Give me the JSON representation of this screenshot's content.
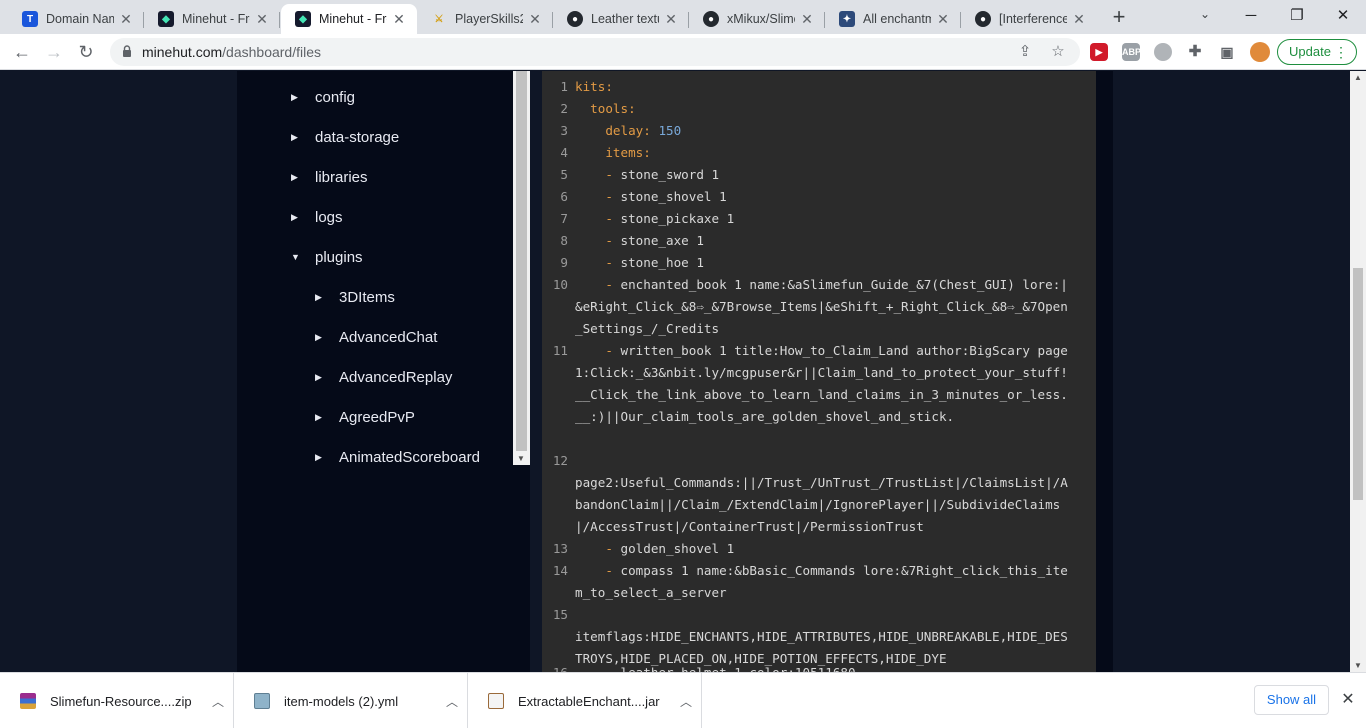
{
  "tabs": [
    {
      "title": "Domain Nam",
      "icon": "tab-favicon-t",
      "active": false
    },
    {
      "title": "Minehut - Fre",
      "icon": "minehut-icon",
      "active": false
    },
    {
      "title": "Minehut - Fre",
      "icon": "minehut-icon",
      "active": true
    },
    {
      "title": "PlayerSkills2 |",
      "icon": "playerskills-icon",
      "active": false
    },
    {
      "title": "Leather textu",
      "icon": "github-icon",
      "active": false
    },
    {
      "title": "xMikux/Slime",
      "icon": "github-icon",
      "active": false
    },
    {
      "title": "All enchantm",
      "icon": "enchantment-icon",
      "active": false
    },
    {
      "title": "[Interference",
      "icon": "github-icon",
      "active": false
    }
  ],
  "toolbar": {
    "url_host": "minehut.com",
    "url_path": "/dashboard/files",
    "update_label": "Update"
  },
  "file_tree": {
    "items": [
      {
        "label": "config",
        "expanded": false,
        "depth": 0
      },
      {
        "label": "data-storage",
        "expanded": false,
        "depth": 0
      },
      {
        "label": "libraries",
        "expanded": false,
        "depth": 0
      },
      {
        "label": "logs",
        "expanded": false,
        "depth": 0
      },
      {
        "label": "plugins",
        "expanded": true,
        "depth": 0
      },
      {
        "label": "3DItems",
        "expanded": false,
        "depth": 1
      },
      {
        "label": "AdvancedChat",
        "expanded": false,
        "depth": 1
      },
      {
        "label": "AdvancedReplay",
        "expanded": false,
        "depth": 1
      },
      {
        "label": "AgreedPvP",
        "expanded": false,
        "depth": 1
      },
      {
        "label": "AnimatedScoreboard",
        "expanded": false,
        "depth": 1
      }
    ]
  },
  "editor": {
    "lines": [
      {
        "n": "1",
        "segs": [
          {
            "t": "kits:",
            "c": "k"
          }
        ]
      },
      {
        "n": "2",
        "segs": [
          {
            "t": "  ",
            "c": ""
          },
          {
            "t": "tools:",
            "c": "k"
          }
        ]
      },
      {
        "n": "3",
        "segs": [
          {
            "t": "    ",
            "c": ""
          },
          {
            "t": "delay:",
            "c": "k"
          },
          {
            "t": " ",
            "c": ""
          },
          {
            "t": "150",
            "c": "n"
          }
        ]
      },
      {
        "n": "4",
        "segs": [
          {
            "t": "    ",
            "c": ""
          },
          {
            "t": "items:",
            "c": "k"
          }
        ]
      },
      {
        "n": "5",
        "segs": [
          {
            "t": "    ",
            "c": ""
          },
          {
            "t": "-",
            "c": "d"
          },
          {
            "t": " stone_sword 1",
            "c": ""
          }
        ]
      },
      {
        "n": "6",
        "segs": [
          {
            "t": "    ",
            "c": ""
          },
          {
            "t": "-",
            "c": "d"
          },
          {
            "t": " stone_shovel 1",
            "c": ""
          }
        ]
      },
      {
        "n": "7",
        "segs": [
          {
            "t": "    ",
            "c": ""
          },
          {
            "t": "-",
            "c": "d"
          },
          {
            "t": " stone_pickaxe 1",
            "c": ""
          }
        ]
      },
      {
        "n": "8",
        "segs": [
          {
            "t": "    ",
            "c": ""
          },
          {
            "t": "-",
            "c": "d"
          },
          {
            "t": " stone_axe 1",
            "c": ""
          }
        ]
      },
      {
        "n": "9",
        "segs": [
          {
            "t": "    ",
            "c": ""
          },
          {
            "t": "-",
            "c": "d"
          },
          {
            "t": " stone_hoe 1",
            "c": ""
          }
        ]
      },
      {
        "n": "10",
        "segs": [
          {
            "t": "    ",
            "c": ""
          },
          {
            "t": "-",
            "c": "d"
          },
          {
            "t": " enchanted_book 1 name:&aSlimefun_Guide_&7(Chest_GUI) lore:|&eRight_Click_&8⇨_&7Browse_Items|&eShift_+_Right_Click_&8⇨_&7Open_Settings_/_Credits",
            "c": ""
          }
        ]
      },
      {
        "n": "11",
        "segs": [
          {
            "t": "    ",
            "c": ""
          },
          {
            "t": "-",
            "c": "d"
          },
          {
            "t": " written_book 1 title:How_to_Claim_Land author:BigScary page1:Click:_&3&nbit.ly/mcgpuser&r||Claim_land_to_protect_your_stuff!__Click_the_link_above_to_learn_land_claims_in_3_minutes_or_less.__:)||Our_claim_tools_are_golden_shovel_and_stick.",
            "c": ""
          }
        ]
      },
      {
        "n": "12",
        "segs": [
          {
            "t": "page2:Useful_Commands:||/Trust_/UnTrust_/TrustList|/ClaimsList|/AbandonClaim||/Claim_/ExtendClaim|/IgnorePlayer||/SubdivideClaims|/AccessTrust|/ContainerTrust|/PermissionTrust",
            "c": ""
          }
        ]
      },
      {
        "n": "13",
        "segs": [
          {
            "t": "    ",
            "c": ""
          },
          {
            "t": "-",
            "c": "d"
          },
          {
            "t": " golden_shovel 1",
            "c": ""
          }
        ]
      },
      {
        "n": "14",
        "segs": [
          {
            "t": "    ",
            "c": ""
          },
          {
            "t": "-",
            "c": "d"
          },
          {
            "t": " compass 1 name:&bBasic_Commands lore:&7Right_click_this_item_to_select_a_server",
            "c": ""
          }
        ]
      },
      {
        "n": "15",
        "segs": [
          {
            "t": "itemflags:HIDE_ENCHANTS,HIDE_ATTRIBUTES,HIDE_UNBREAKABLE,HIDE_DESTROYS,HIDE_PLACED_ON,HIDE_POTION_EFFECTS,HIDE_DYE",
            "c": ""
          }
        ]
      },
      {
        "n": "16",
        "segs": [
          {
            "t": "    ",
            "c": ""
          },
          {
            "t": "-",
            "c": "d"
          },
          {
            "t": " leather_helmet 1 color:10511680",
            "c": ""
          }
        ]
      }
    ]
  },
  "downloads": {
    "items": [
      {
        "name": "Slimefun-Resource....zip",
        "icon": "zip-archive-icon"
      },
      {
        "name": "item-models (2).yml",
        "icon": "yml-file-icon"
      },
      {
        "name": "ExtractableEnchant....jar",
        "icon": "jar-file-icon"
      }
    ],
    "show_all_label": "Show all"
  }
}
